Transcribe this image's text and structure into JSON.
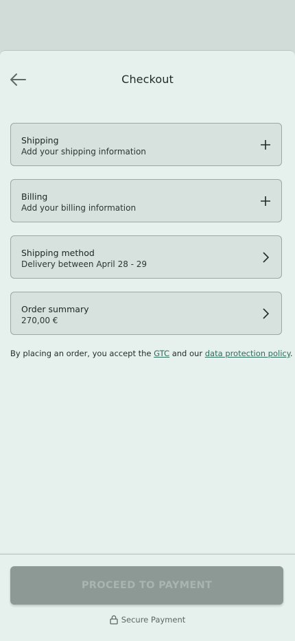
{
  "header": {
    "title": "Checkout",
    "back_icon": "arrow-left-icon"
  },
  "sections": [
    {
      "title": "Shipping",
      "subtitle": "Add your shipping information",
      "icon": "plus-icon"
    },
    {
      "title": "Billing",
      "subtitle": "Add your billing information",
      "icon": "plus-icon"
    },
    {
      "title": "Shipping method",
      "subtitle": "Delivery between April 28 - 29",
      "icon": "chevron-right-icon"
    },
    {
      "title": "Order summary",
      "subtitle": "270,00 €",
      "icon": "chevron-right-icon"
    }
  ],
  "legal": {
    "prefix": "By placing an order, you accept the ",
    "gtc_link": "GTC",
    "middle": " and our ",
    "privacy_link": "data protection policy",
    "suffix": "."
  },
  "footer": {
    "pay_button": "PROCEED TO PAYMENT",
    "pay_button_enabled": false,
    "secure_label": "Secure Payment",
    "secure_icon": "lock-icon"
  },
  "colors": {
    "backdrop": "#d1dbd8",
    "sheet": "#e6f0ec",
    "card": "#d7e2de",
    "link": "#2f6b5a",
    "button_disabled": "#8c9995"
  }
}
